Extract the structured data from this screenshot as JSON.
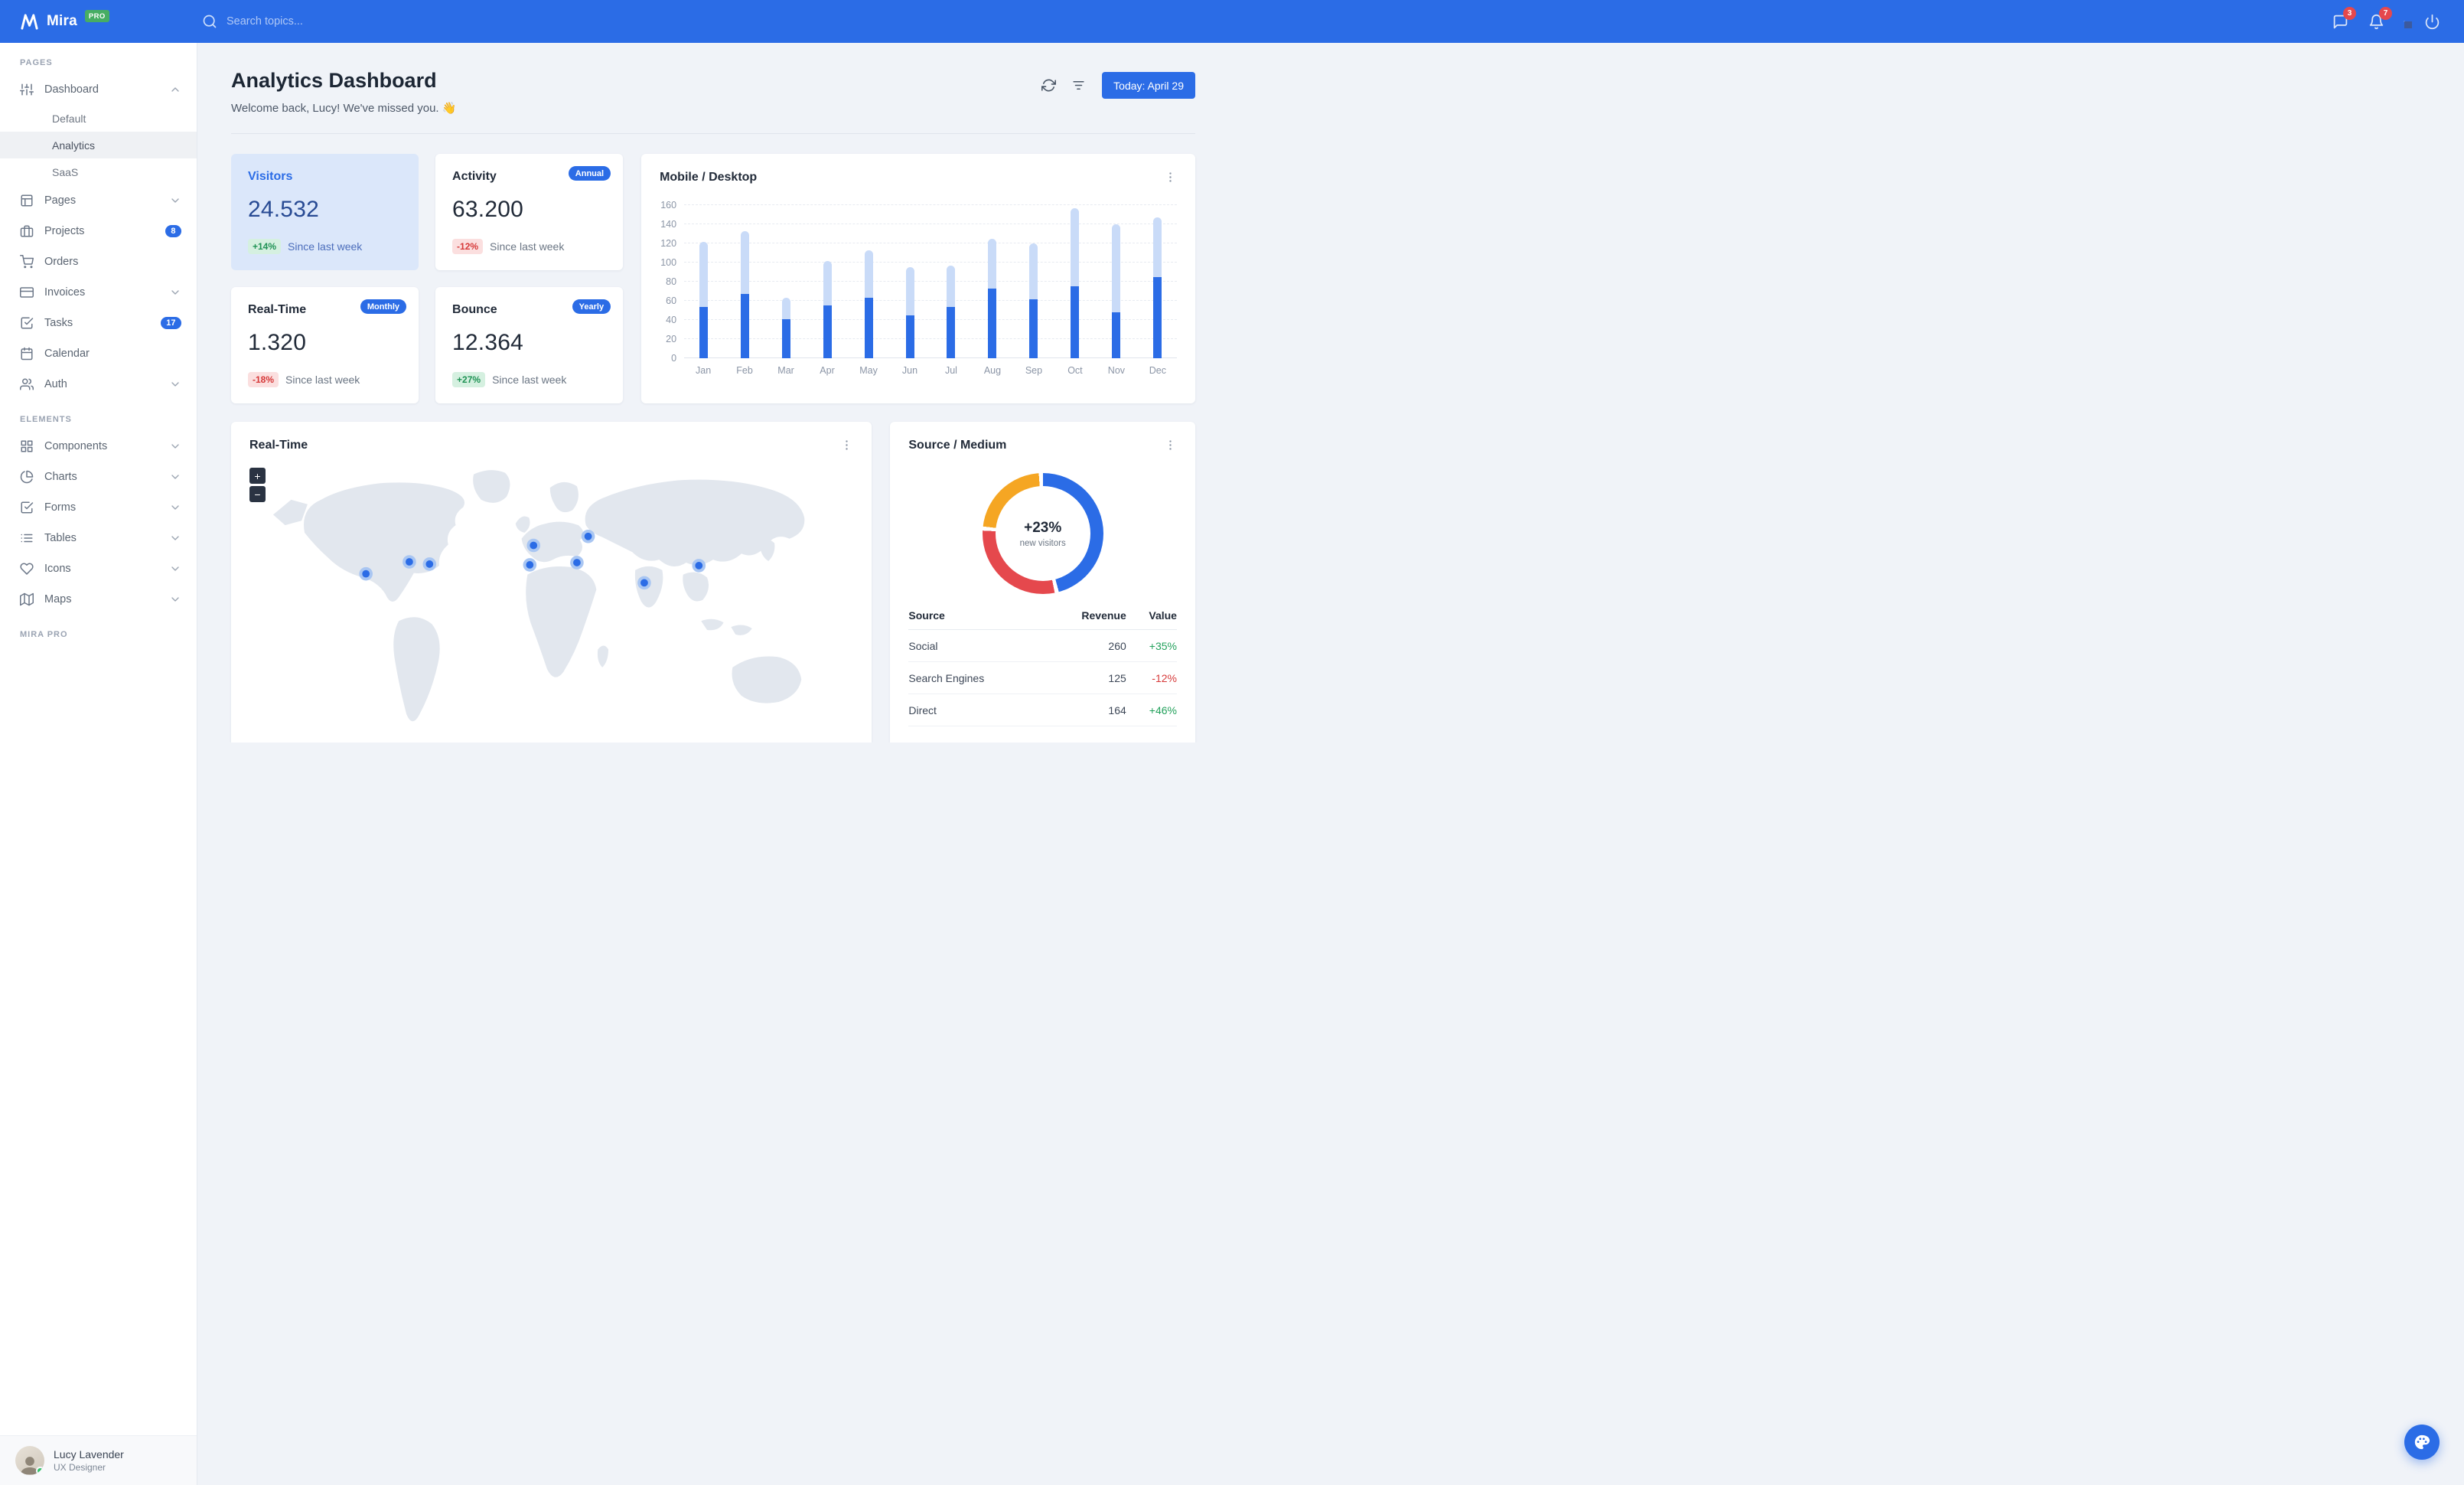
{
  "navbar": {
    "brand": "Mira",
    "brand_badge": "PRO",
    "search_placeholder": "Search topics...",
    "messages_badge": "3",
    "notifications_badge": "7"
  },
  "sidebar": {
    "section_pages": "Pages",
    "section_elements": "Elements",
    "section_pro": "Mira Pro",
    "items": {
      "dashboard": "Dashboard",
      "dashboard_children": [
        "Default",
        "Analytics",
        "SaaS"
      ],
      "pages": "Pages",
      "projects": "Projects",
      "projects_badge": "8",
      "orders": "Orders",
      "invoices": "Invoices",
      "tasks": "Tasks",
      "tasks_badge": "17",
      "calendar": "Calendar",
      "auth": "Auth",
      "components": "Components",
      "charts": "Charts",
      "forms": "Forms",
      "tables": "Tables",
      "icons": "Icons",
      "maps": "Maps"
    },
    "user": {
      "name": "Lucy Lavender",
      "role": "UX Designer"
    }
  },
  "header": {
    "title": "Analytics Dashboard",
    "subtitle": "Welcome back, Lucy! We've missed you. 👋",
    "date_button": "Today: April 29"
  },
  "stats": [
    {
      "title": "Visitors",
      "value": "24.532",
      "delta": "+14%",
      "caption": "Since last week"
    },
    {
      "title": "Activity",
      "value": "63.200",
      "delta": "-12%",
      "caption": "Since last week",
      "period": "Annual"
    },
    {
      "title": "Real-Time",
      "value": "1.320",
      "delta": "-18%",
      "caption": "Since last week",
      "period": "Monthly"
    },
    {
      "title": "Bounce",
      "value": "12.364",
      "delta": "+27%",
      "caption": "Since last week",
      "period": "Yearly"
    }
  ],
  "chart_data": [
    {
      "type": "bar",
      "title": "Mobile / Desktop",
      "stacked": true,
      "categories": [
        "Jan",
        "Feb",
        "Mar",
        "Apr",
        "May",
        "Jun",
        "Jul",
        "Aug",
        "Sep",
        "Oct",
        "Nov",
        "Dec"
      ],
      "series": [
        {
          "name": "Mobile",
          "color": "#2b6ce6",
          "values": [
            54,
            67,
            41,
            55,
            63,
            45,
            54,
            73,
            62,
            75,
            48,
            85
          ]
        },
        {
          "name": "Desktop",
          "color": "#c9dbf8",
          "values": [
            68,
            66,
            22,
            47,
            50,
            50,
            43,
            52,
            58,
            82,
            92,
            62
          ]
        }
      ],
      "ylim": [
        0,
        160
      ],
      "yticks": [
        0,
        20,
        40,
        60,
        80,
        100,
        120,
        140,
        160
      ],
      "grid": true,
      "legend": "none"
    },
    {
      "type": "pie",
      "donut": true,
      "title": "Source / Medium",
      "center_value": "+23%",
      "center_caption": "new visitors",
      "slices": [
        {
          "label": "Social",
          "value": 260,
          "color": "#2b6ce6"
        },
        {
          "label": "Direct",
          "value": 164,
          "color": "#e5484d"
        },
        {
          "label": "Search Engines",
          "value": 125,
          "color": "#f5a623"
        }
      ]
    }
  ],
  "realtime_map": {
    "title": "Real-Time",
    "zoom_in": "+",
    "zoom_out": "−",
    "markers": [
      {
        "x": 152,
        "y": 151
      },
      {
        "x": 210,
        "y": 135
      },
      {
        "x": 237,
        "y": 138
      },
      {
        "x": 371,
        "y": 139
      },
      {
        "x": 376,
        "y": 113
      },
      {
        "x": 434,
        "y": 136
      },
      {
        "x": 449,
        "y": 101
      },
      {
        "x": 524,
        "y": 163
      },
      {
        "x": 597,
        "y": 140
      }
    ]
  },
  "source_table": {
    "headers": [
      "Source",
      "Revenue",
      "Value"
    ],
    "rows": [
      {
        "source": "Social",
        "revenue": "260",
        "value": "+35%",
        "trend": "positive"
      },
      {
        "source": "Search Engines",
        "revenue": "125",
        "value": "-12%",
        "trend": "negative"
      },
      {
        "source": "Direct",
        "revenue": "164",
        "value": "+46%",
        "trend": "positive"
      }
    ]
  },
  "colors": {
    "primary": "#2b6ce6",
    "positive": "#1f9254",
    "negative": "#d63939",
    "highlight_card": "#dbe7fa"
  }
}
